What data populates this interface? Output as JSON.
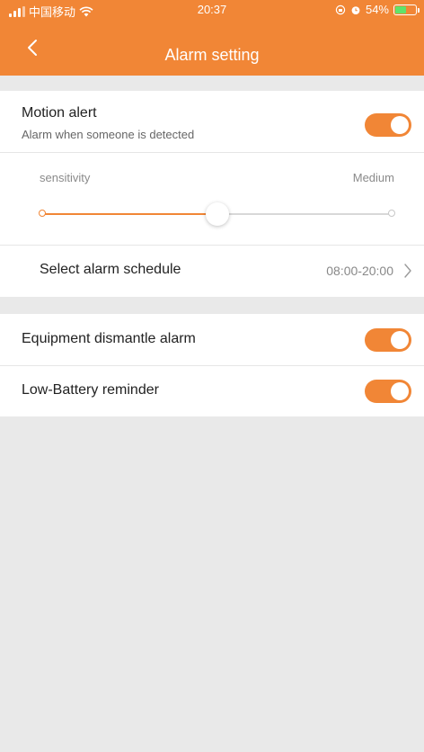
{
  "colors": {
    "accent": "#f18636",
    "background": "#e9e9e9",
    "battery": "#5fe36b"
  },
  "status_bar": {
    "carrier": "中国移动",
    "time": "20:37",
    "battery_percent": "54%",
    "battery_level": 0.54,
    "icons": [
      "signal-icon",
      "wifi-icon",
      "orientation-lock-icon",
      "alarm-icon",
      "battery-charging-icon"
    ]
  },
  "header": {
    "title": "Alarm setting",
    "back_icon": "chevron-left-icon"
  },
  "motion_alert": {
    "title": "Motion alert",
    "subtitle": "Alarm when someone is detected",
    "enabled": true
  },
  "sensitivity": {
    "label": "sensitivity",
    "value_label": "Medium",
    "level": 0.5
  },
  "schedule": {
    "label": "Select alarm schedule",
    "value": "08:00-20:00",
    "icon": "chevron-right-icon"
  },
  "equipment_dismantle": {
    "label": "Equipment dismantle alarm",
    "enabled": true
  },
  "low_battery": {
    "label": "Low-Battery reminder",
    "enabled": true
  }
}
